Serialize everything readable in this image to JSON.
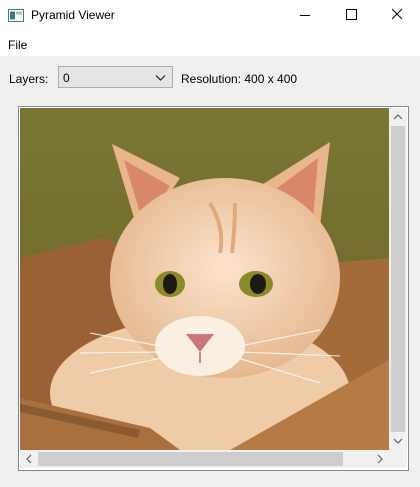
{
  "window": {
    "title": "Pyramid Viewer"
  },
  "menu": {
    "items": [
      "File"
    ]
  },
  "toolbar": {
    "layers_label": "Layers:",
    "layers_value": "0",
    "resolution_label": "Resolution: 400 x 400"
  },
  "colors": {
    "background": "#f0f0f0",
    "scroll_thumb": "#cdcdcd",
    "image_backdrop": "#7d7a33",
    "box_cardboard": "#a86e3e",
    "cat_fur": "#efc9a6"
  },
  "icons": {
    "app": "app-window-icon",
    "minimize": "minimize-icon",
    "maximize": "maximize-icon",
    "close": "close-icon",
    "dropdown": "chevron-down-icon",
    "scroll_up": "scroll-up-arrow-icon",
    "scroll_down": "scroll-down-arrow-icon",
    "scroll_left": "scroll-left-arrow-icon",
    "scroll_right": "scroll-right-arrow-icon"
  }
}
